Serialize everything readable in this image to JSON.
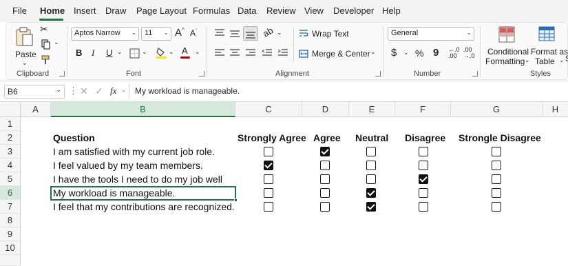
{
  "menu": {
    "tabs": [
      "File",
      "Home",
      "Insert",
      "Draw",
      "Page Layout",
      "Formulas",
      "Data",
      "Review",
      "View",
      "Developer",
      "Help"
    ],
    "active": "Home"
  },
  "ribbon": {
    "clipboard": {
      "paste_label": "Paste",
      "group_label": "Clipboard"
    },
    "font": {
      "family": "Aptos Narrow",
      "size": "11",
      "bold": "B",
      "italic": "I",
      "underline": "U",
      "grow": "A",
      "shrink": "A",
      "color_letter": "A",
      "group_label": "Font"
    },
    "alignment": {
      "wrap_text": "Wrap Text",
      "merge_center": "Merge & Center",
      "group_label": "Alignment"
    },
    "number": {
      "format": "General",
      "currency": "$",
      "percent": "%",
      "comma": "9",
      "group_label": "Number"
    },
    "styles": {
      "conditional_line1": "Conditional",
      "conditional_line2": "Formatting",
      "table_line1": "Format as",
      "table_line2": "Table",
      "partial_cell": "S",
      "group_label": "Styles"
    }
  },
  "formula_bar": {
    "name_box": "B6",
    "fx": "fx",
    "formula": "My workload is manageable."
  },
  "sheet": {
    "columns": [
      "A",
      "B",
      "C",
      "D",
      "E",
      "F",
      "G",
      "H"
    ],
    "rows": [
      "1",
      "2",
      "3",
      "4",
      "5",
      "6",
      "7",
      "8",
      "9",
      "10"
    ],
    "selected_cell": "B6",
    "headers": {
      "question": "Question",
      "c": "Strongly Agree",
      "d": "Agree",
      "e": "Neutral",
      "f": "Disagree",
      "g": "Strongle Disagree"
    },
    "questions": [
      {
        "text": "I am satisfied with my current job role.",
        "checks": [
          false,
          true,
          false,
          false,
          false
        ]
      },
      {
        "text": "I feel valued by my team members.",
        "checks": [
          true,
          false,
          false,
          false,
          false
        ]
      },
      {
        "text": "I have the tools I need to do my job well",
        "checks": [
          false,
          false,
          false,
          true,
          false
        ]
      },
      {
        "text": "My workload is manageable.",
        "checks": [
          false,
          false,
          true,
          false,
          false
        ]
      },
      {
        "text": "I feel that my contributions are recognized.",
        "checks": [
          false,
          false,
          true,
          false,
          false
        ]
      }
    ]
  },
  "colors": {
    "accent": "#1e7145",
    "header_bg": "#f5f5f5",
    "selected_header_bg": "#d7e8dc"
  }
}
